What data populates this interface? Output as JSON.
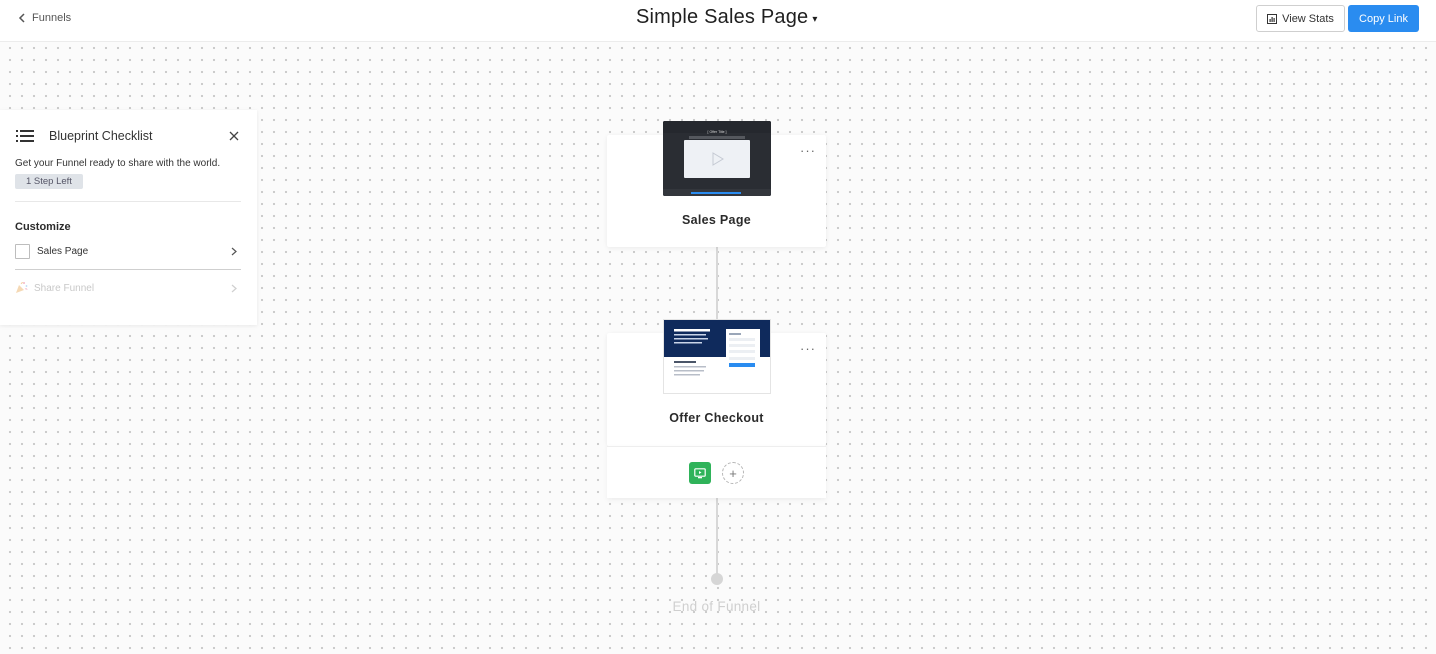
{
  "header": {
    "back_label": "Funnels",
    "title": "Simple Sales Page",
    "view_stats_label": "View Stats",
    "copy_link_label": "Copy Link"
  },
  "checklist": {
    "title": "Blueprint Checklist",
    "description": "Get your Funnel ready to share with the world.",
    "steps_left": "1 Step Left",
    "section_title": "Customize",
    "items": [
      {
        "label": "Sales Page",
        "checked": false,
        "enabled": true
      },
      {
        "label": "Share Funnel",
        "enabled": false,
        "icon": "party-popper-icon"
      }
    ]
  },
  "funnel": {
    "steps": [
      {
        "label": "Sales Page",
        "thumbnail": "video-sales-page",
        "thumbnail_caption": "[ Offer Title ]"
      },
      {
        "label": "Offer Checkout",
        "thumbnail": "checkout-page"
      }
    ],
    "end_label": "End of Funnel"
  },
  "colors": {
    "primary": "#2a8cf0",
    "success": "#2fb35a",
    "thumbnail_dark": "#2a2d33",
    "thumbnail_navy": "#0f2a5c"
  }
}
